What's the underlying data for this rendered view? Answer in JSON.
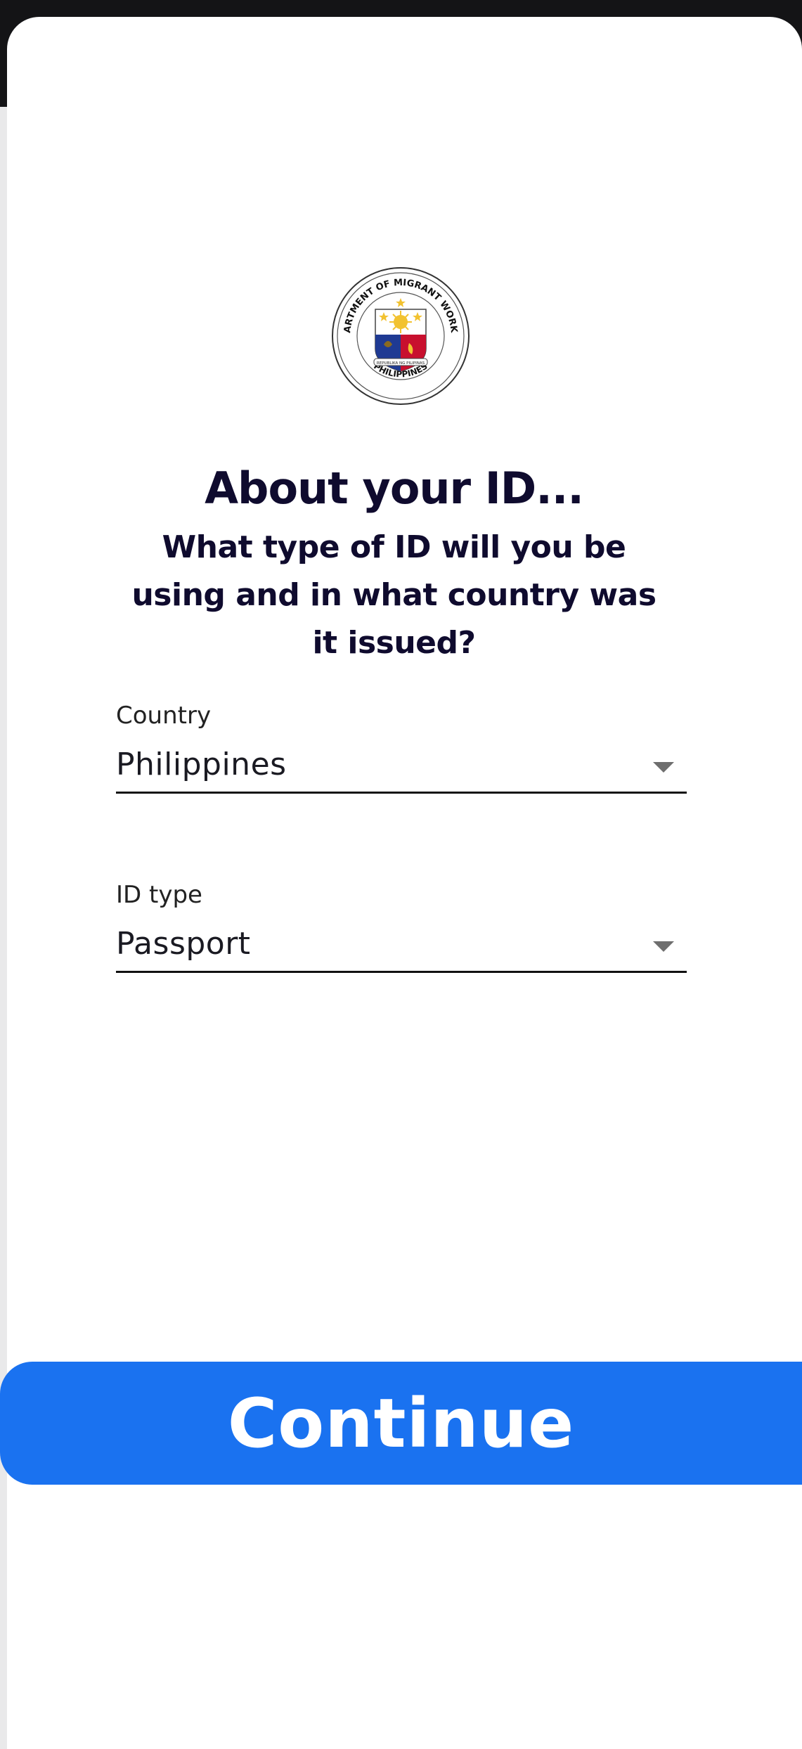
{
  "header": {
    "title": "About your ID...",
    "subtitle": "What type of ID will you be using and in what country was it issued?"
  },
  "logo": {
    "icon": "department-of-migrant-workers-seal-icon",
    "ring_text_top": "DEPARTMENT OF MIGRANT WORKERS",
    "ring_text_bottom": "PHILIPPINES",
    "inner_text": "REPUBLIKA NG PILIPINAS"
  },
  "form": {
    "country": {
      "label": "Country",
      "value": "Philippines",
      "icon": "dropdown-caret-icon"
    },
    "id_type": {
      "label": "ID type",
      "value": "Passport",
      "icon": "dropdown-caret-icon"
    }
  },
  "actions": {
    "continue_label": "Continue"
  },
  "colors": {
    "primary": "#1a72f0",
    "title_text": "#0f0b2e",
    "top_bar": "#141416"
  }
}
